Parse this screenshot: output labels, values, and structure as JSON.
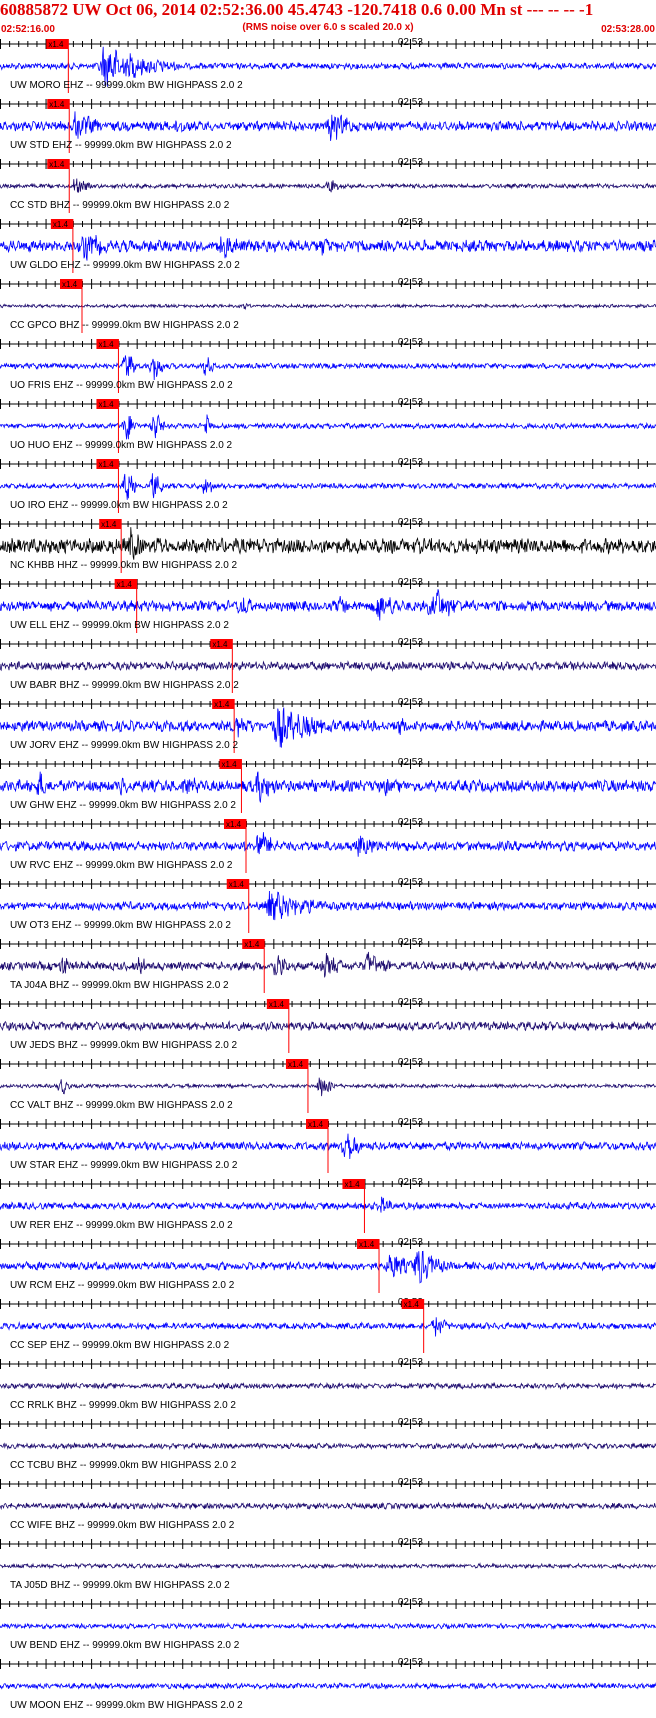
{
  "header": {
    "title": "60885872 UW Oct 06, 2014 02:52:36.00   45.4743 -120.7418  0.6 0.00 Mn st --- -- --  -1",
    "subtitle": "(RMS noise over 6.0 s scaled 20.0 x)",
    "time_start": "02:52:16.00",
    "time_end": "02:53:28.00"
  },
  "chart_data": {
    "type": "seismogram",
    "time_axis": {
      "start": "02:52:16.00",
      "end": "02:53:28.00",
      "minute_label": "02:53",
      "tick_interval_s": 1
    },
    "pick_label": "x1.4",
    "colors": {
      "trace_blue": "#0000ff",
      "trace_purple": "#1c0a6e",
      "trace_black": "#000000",
      "pick_red": "#ff0000",
      "tick": "#000000"
    },
    "traces": [
      {
        "label": "UW MORO EHZ -- 99999.0km BW  HIGHPASS  2.0  2",
        "color": "blue",
        "pick_s": 7.5,
        "noise": 0.12,
        "events": [
          {
            "t": 11,
            "amp": 0.95,
            "dur": 9
          }
        ]
      },
      {
        "label": "UW STD EHZ -- 99999.0km BW  HIGHPASS  2.0  2",
        "color": "blue",
        "pick_s": 7.6,
        "noise": 0.18,
        "events": [
          {
            "t": 8,
            "amp": 0.8,
            "dur": 4
          },
          {
            "t": 19,
            "amp": 0.5,
            "dur": 3
          },
          {
            "t": 36,
            "amp": 0.8,
            "dur": 4
          }
        ]
      },
      {
        "label": "CC STD BHZ -- 99999.0km BW  HIGHPASS  2.0  2",
        "color": "purple",
        "pick_s": 7.6,
        "noise": 0.08,
        "events": [
          {
            "t": 8,
            "amp": 0.6,
            "dur": 2
          },
          {
            "t": 36,
            "amp": 0.4,
            "dur": 2
          }
        ]
      },
      {
        "label": "UW GLDO EHZ -- 99999.0km BW  HIGHPASS  2.0  2",
        "color": "blue",
        "pick_s": 8.0,
        "noise": 0.22,
        "events": [
          {
            "t": 9,
            "amp": 0.8,
            "dur": 4
          },
          {
            "t": 24,
            "amp": 0.55,
            "dur": 6
          },
          {
            "t": 35,
            "amp": 0.5,
            "dur": 3
          }
        ]
      },
      {
        "label": "CC GPCO BHZ -- 99999.0km BW  HIGHPASS  2.0  2",
        "color": "purple",
        "pick_s": 9.0,
        "noise": 0.06,
        "events": [
          {
            "t": 27,
            "amp": 0.5,
            "dur": 0.4
          }
        ]
      },
      {
        "label": "UO FRIS EHZ -- 99999.0km BW  HIGHPASS  2.0  2",
        "color": "blue",
        "pick_s": 13.0,
        "noise": 0.1,
        "events": [
          {
            "t": 13.6,
            "amp": 1.0,
            "dur": 1.5
          },
          {
            "t": 16.6,
            "amp": 1.0,
            "dur": 1.5
          },
          {
            "t": 22.5,
            "amp": 1.0,
            "dur": 1.0
          }
        ]
      },
      {
        "label": "UO HUO EHZ -- 99999.0km BW  HIGHPASS  2.0  2",
        "color": "blue",
        "pick_s": 13.0,
        "noise": 0.1,
        "events": [
          {
            "t": 13.6,
            "amp": 1.0,
            "dur": 1.5
          },
          {
            "t": 16.6,
            "amp": 1.0,
            "dur": 1.5
          },
          {
            "t": 22.5,
            "amp": 1.0,
            "dur": 1.0
          }
        ]
      },
      {
        "label": "UO IRO EHZ -- 99999.0km BW  HIGHPASS  2.0  2",
        "color": "blue",
        "pick_s": 13.0,
        "noise": 0.1,
        "events": [
          {
            "t": 13.6,
            "amp": 1.0,
            "dur": 1.5
          },
          {
            "t": 16.6,
            "amp": 1.0,
            "dur": 1.5
          },
          {
            "t": 22.5,
            "amp": 1.0,
            "dur": 1.0
          }
        ]
      },
      {
        "label": "NC KHBB HHZ -- 99999.0km BW  HIGHPASS  2.0  2",
        "color": "black",
        "pick_s": 13.3,
        "noise": 0.28,
        "events": [
          {
            "t": 14,
            "amp": 0.9,
            "dur": 3
          },
          {
            "t": 17,
            "amp": 0.6,
            "dur": 2
          }
        ]
      },
      {
        "label": "UW ELL EHZ -- 99999.0km BW  HIGHPASS  2.0  2",
        "color": "blue",
        "pick_s": 15.0,
        "noise": 0.2,
        "events": [
          {
            "t": 26,
            "amp": 0.6,
            "dur": 3
          },
          {
            "t": 37,
            "amp": 0.5,
            "dur": 3
          },
          {
            "t": 41,
            "amp": 0.8,
            "dur": 4
          },
          {
            "t": 47,
            "amp": 0.9,
            "dur": 5
          }
        ]
      },
      {
        "label": "UW BABR BHZ -- 99999.0km BW  HIGHPASS  2.0  2",
        "color": "purple",
        "pick_s": 25.5,
        "noise": 0.16,
        "events": []
      },
      {
        "label": "UW JORV EHZ -- 99999.0km BW  HIGHPASS  2.0  2",
        "color": "blue",
        "pick_s": 25.7,
        "noise": 0.2,
        "events": [
          {
            "t": 25.5,
            "amp": 0.6,
            "dur": 4
          },
          {
            "t": 30,
            "amp": 1.0,
            "dur": 8
          },
          {
            "t": 43.5,
            "amp": 0.6,
            "dur": 2
          }
        ]
      },
      {
        "label": "UW GHW EHZ -- 99999.0km BW  HIGHPASS  2.0  2",
        "color": "blue",
        "pick_s": 26.5,
        "noise": 0.22,
        "events": [
          {
            "t": 4,
            "amp": 0.7,
            "dur": 3
          },
          {
            "t": 13,
            "amp": 0.6,
            "dur": 2
          },
          {
            "t": 20,
            "amp": 0.7,
            "dur": 3
          },
          {
            "t": 28,
            "amp": 0.8,
            "dur": 4
          },
          {
            "t": 42,
            "amp": 0.5,
            "dur": 3
          }
        ]
      },
      {
        "label": "UW RVC EHZ -- 99999.0km BW  HIGHPASS  2.0  2",
        "color": "blue",
        "pick_s": 27.0,
        "noise": 0.18,
        "events": [
          {
            "t": 28,
            "amp": 0.9,
            "dur": 3
          },
          {
            "t": 39,
            "amp": 0.5,
            "dur": 6
          }
        ]
      },
      {
        "label": "UW OT3 EHZ -- 99999.0km BW  HIGHPASS  2.0  2",
        "color": "blue",
        "pick_s": 27.3,
        "noise": 0.16,
        "events": [
          {
            "t": 29,
            "amp": 0.7,
            "dur": 10
          }
        ]
      },
      {
        "label": "TA J04A BHZ -- 99999.0km BW  HIGHPASS  2.0  2",
        "color": "purple",
        "pick_s": 29.0,
        "noise": 0.16,
        "events": [
          {
            "t": 6.5,
            "amp": 0.7,
            "dur": 2
          },
          {
            "t": 15,
            "amp": 0.6,
            "dur": 2
          },
          {
            "t": 30,
            "amp": 0.9,
            "dur": 2
          },
          {
            "t": 35,
            "amp": 0.7,
            "dur": 4
          },
          {
            "t": 40,
            "amp": 0.7,
            "dur": 4
          }
        ]
      },
      {
        "label": "UW JEDS BHZ -- 99999.0km BW  HIGHPASS  2.0  2",
        "color": "purple",
        "pick_s": 31.7,
        "noise": 0.16,
        "events": []
      },
      {
        "label": "CC VALT BHZ -- 99999.0km BW  HIGHPASS  2.0  2",
        "color": "purple",
        "pick_s": 33.8,
        "noise": 0.07,
        "events": [
          {
            "t": 6.5,
            "amp": 0.55,
            "dur": 1.5
          },
          {
            "t": 35,
            "amp": 0.8,
            "dur": 2
          }
        ]
      },
      {
        "label": "UW STAR EHZ -- 99999.0km BW  HIGHPASS  2.0  2",
        "color": "blue",
        "pick_s": 36.0,
        "noise": 0.15,
        "events": [
          {
            "t": 37.5,
            "amp": 0.9,
            "dur": 3
          }
        ]
      },
      {
        "label": "UW RER EHZ -- 99999.0km BW  HIGHPASS  2.0  2",
        "color": "blue",
        "pick_s": 40.0,
        "noise": 0.13,
        "events": [
          {
            "t": 41.5,
            "amp": 0.6,
            "dur": 2
          }
        ]
      },
      {
        "label": "UW RCM EHZ -- 99999.0km BW  HIGHPASS  2.0  2",
        "color": "blue",
        "pick_s": 41.6,
        "noise": 0.15,
        "events": [
          {
            "t": 42.5,
            "amp": 0.7,
            "dur": 4
          },
          {
            "t": 45.5,
            "amp": 1.0,
            "dur": 4
          }
        ]
      },
      {
        "label": "CC SEP EHZ -- 99999.0km BW  HIGHPASS  2.0  2",
        "color": "blue",
        "pick_s": 46.5,
        "noise": 0.12,
        "events": [
          {
            "t": 47.5,
            "amp": 0.7,
            "dur": 2
          }
        ]
      },
      {
        "label": "CC RRLK BHZ -- 99999.0km BW  HIGHPASS  2.0  2",
        "color": "purple",
        "pick_s": null,
        "noise": 0.1,
        "events": []
      },
      {
        "label": "CC TCBU BHZ -- 99999.0km BW  HIGHPASS  2.0  2",
        "color": "purple",
        "pick_s": null,
        "noise": 0.1,
        "events": []
      },
      {
        "label": "CC WIFE BHZ -- 99999.0km BW  HIGHPASS  2.0  2",
        "color": "purple",
        "pick_s": null,
        "noise": 0.11,
        "events": []
      },
      {
        "label": "TA J05D BHZ -- 99999.0km BW  HIGHPASS  2.0  2",
        "color": "purple",
        "pick_s": null,
        "noise": 0.08,
        "events": []
      },
      {
        "label": "UW BEND EHZ -- 99999.0km BW  HIGHPASS  2.0  2",
        "color": "blue",
        "pick_s": null,
        "noise": 0.09,
        "events": []
      },
      {
        "label": "UW MOON EHZ -- 99999.0km BW  HIGHPASS  2.0  2",
        "color": "blue",
        "pick_s": null,
        "noise": 0.1,
        "events": []
      }
    ]
  }
}
